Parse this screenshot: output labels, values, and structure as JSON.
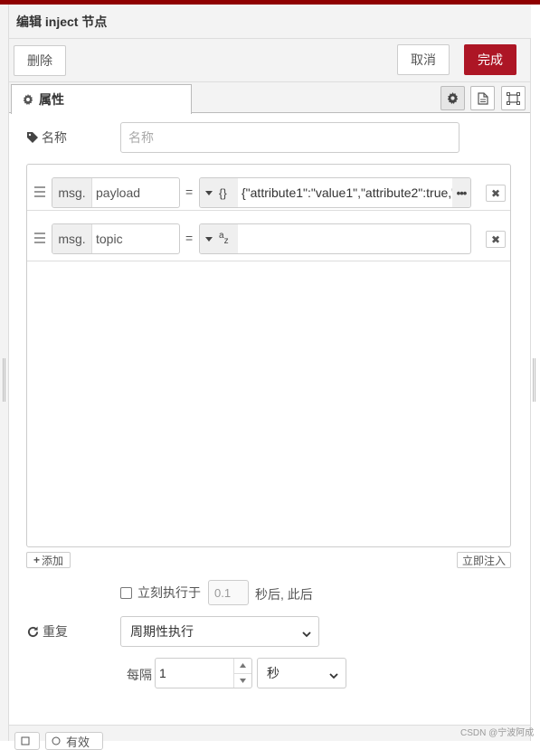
{
  "window": {
    "title": "编辑 inject 节点"
  },
  "toolbar": {
    "delete_label": "删除",
    "cancel_label": "取消",
    "done_label": "完成"
  },
  "tabs": {
    "properties_label": "属性"
  },
  "form": {
    "name_label": "名称",
    "name_placeholder": "名称",
    "name_value": ""
  },
  "properties": {
    "rows": [
      {
        "prefix": "msg.",
        "key": "payload",
        "equals": "=",
        "type_icon": "{}",
        "value": "{\"attribute1\":\"value1\",\"attribute2\":true,\"",
        "has_expand": true
      },
      {
        "prefix": "msg.",
        "key": "topic",
        "equals": "=",
        "type_icon": "az",
        "value": "",
        "has_expand": false
      }
    ],
    "add_label": "添加",
    "inject_now_label": "立即注入"
  },
  "inject_once": {
    "label": "立刻执行于",
    "delay_placeholder": "0.1",
    "suffix": "秒后, 此后",
    "checked": false
  },
  "repeat": {
    "label": "重复",
    "mode_value": "周期性执行",
    "every_label": "每隔",
    "interval_value": "1",
    "unit_value": "秒"
  },
  "footer": {
    "enable_label": "有效"
  },
  "watermark": "CSDN @宁波阿成",
  "colors": {
    "accent": "#ad1625",
    "top_border": "#8f0000"
  },
  "icons": {
    "properties_tab": "gear-icon",
    "name": "tag-icon",
    "repeat": "refresh-icon",
    "drag": "drag-handle-icon",
    "remove": "close-icon",
    "add": "plus-icon"
  }
}
